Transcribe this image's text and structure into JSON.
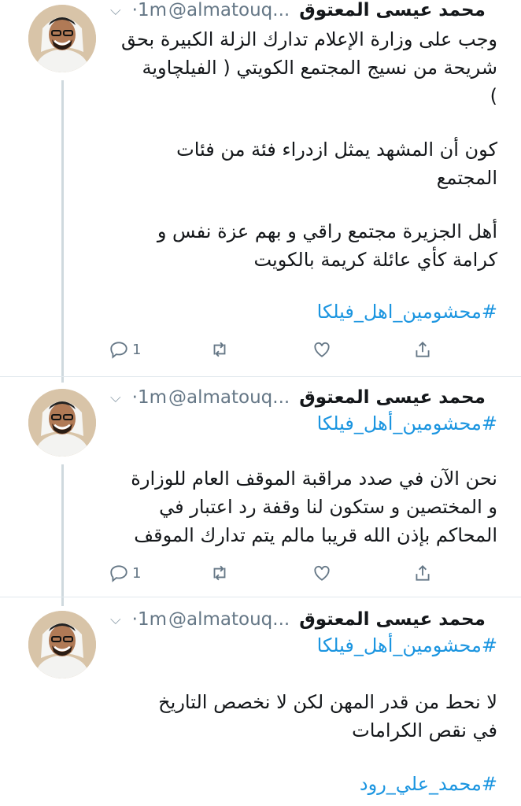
{
  "tweets": [
    {
      "name": "محمد عيسى المعتوق",
      "handle": "@almatouq...",
      "time": "·1m",
      "lines": [
        "وجب على وزارة الإعلام تدارك الزلة الكبيرة بحق",
        "شريحة من نسيج المجتمع الكويتي ( الفيلچاوية",
        ")",
        "كون أن المشهد يمثل ازدراء فئة من فئات",
        "المجتمع",
        "أهل الجزيرة مجتمع راقي و بهم عزة نفس و",
        "كرامة كأي عائلة كريمة بالكويت"
      ],
      "hashtag": "#محشومين_اهل_فيلكا",
      "reply_count": "1"
    },
    {
      "name": "محمد عيسى المعتوق",
      "handle": "@almatouq...",
      "time": "·1m",
      "hashtag_top": "#محشومين_أهل_فيلكا",
      "lines": [
        "نحن الآن في صدد مراقبة الموقف العام للوزارة",
        "و المختصين و ستكون لنا وقفة رد اعتبار في",
        "المحاكم بإذن الله قريبا مالم يتم تدارك الموقف"
      ],
      "reply_count": "1"
    },
    {
      "name": "محمد عيسى المعتوق",
      "handle": "@almatouq...",
      "time": "·1m",
      "hashtag_top": "#محشومين_أهل_فيلكا",
      "lines": [
        "لا نحط من قدر المهن لكن لا نخصص التاريخ",
        "في نقص الكرامات"
      ],
      "hashtag": "#محمد_علي_رود"
    }
  ],
  "icons": {
    "caret": "chevron-down-icon",
    "reply": "reply-icon",
    "retweet": "retweet-icon",
    "like": "heart-icon",
    "share": "share-icon"
  },
  "colors": {
    "link": "#1b95e0",
    "muted": "#657786",
    "line": "#cfd9de"
  }
}
